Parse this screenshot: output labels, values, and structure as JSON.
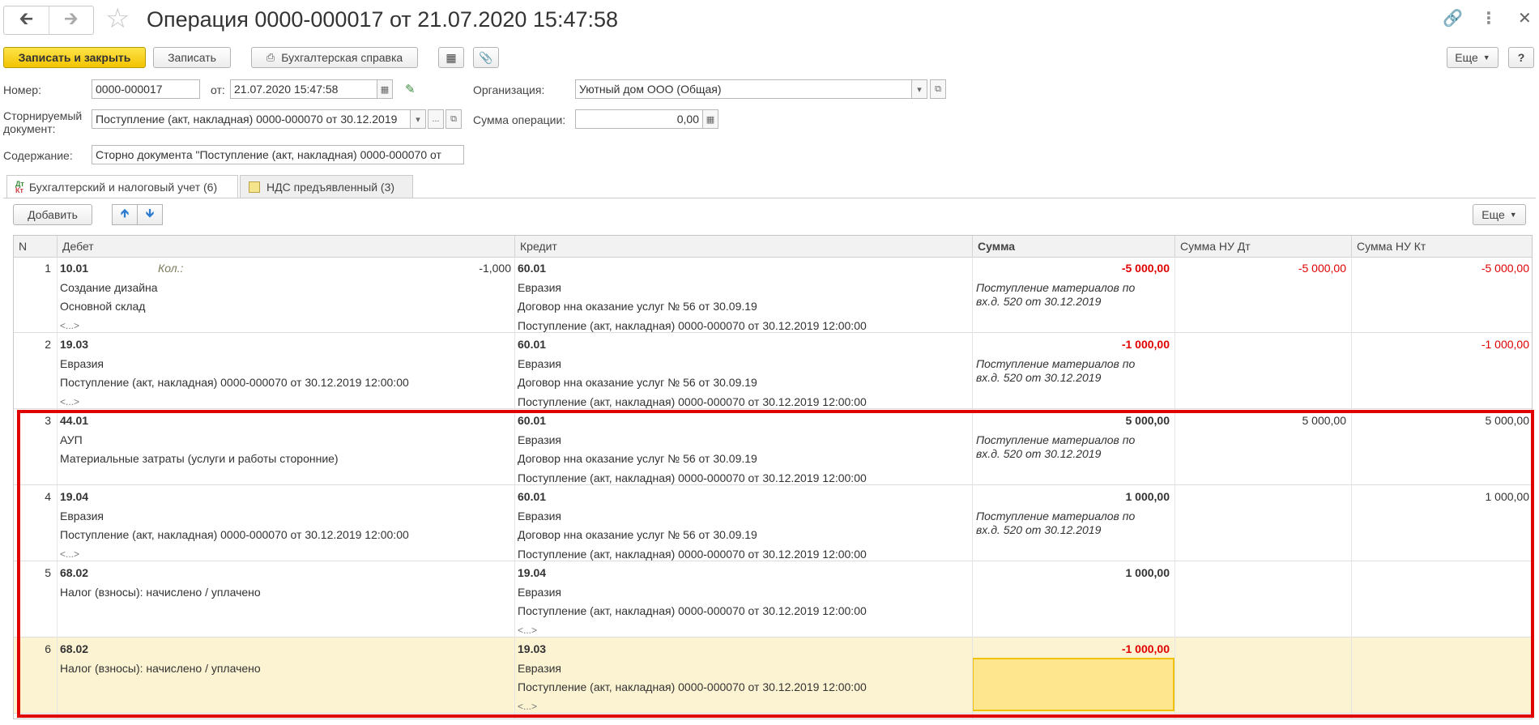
{
  "window": {
    "title": "Операция 0000-000017 от 21.07.2020 15:47:58"
  },
  "toolbar": {
    "save_close": "Записать и закрыть",
    "save": "Записать",
    "report": "Бухгалтерская справка",
    "more": "Еще",
    "help": "?"
  },
  "form": {
    "number_label": "Номер:",
    "number_value": "0000-000017",
    "date_label": "от:",
    "date_value": "21.07.2020 15:47:58",
    "org_label": "Организация:",
    "org_value": "Уютный дом ООО (Общая)",
    "storno_label_1": "Сторнируемый",
    "storno_label_2": "документ:",
    "storno_value": "Поступление (акт, накладная) 0000-000070 от 30.12.2019",
    "storno_more": "...",
    "sum_label": "Сумма операции:",
    "sum_value": "0,00",
    "content_label": "Содержание:",
    "content_value": "Сторно документа \"Поступление (акт, накладная) 0000-000070 от"
  },
  "tabs": [
    {
      "label": "Бухгалтерский и налоговый учет (6)",
      "icon_top": "Дт",
      "icon_bottom": "Кт"
    },
    {
      "label": "НДС предъявленный (3)"
    }
  ],
  "grid_toolbar": {
    "add": "Добавить",
    "more": "Еще"
  },
  "columns": [
    "N",
    "Дебет",
    "Кредит",
    "Сумма",
    "Сумма НУ Дт",
    "Сумма НУ Кт"
  ],
  "rows": [
    {
      "n": "1",
      "debit": [
        "10.01",
        "Создание дизайна",
        "Основной склад",
        "<...>"
      ],
      "qty_label": "Кол.:",
      "qty_value": "-1,000",
      "credit": [
        "60.01",
        "Евразия",
        "Договор нна оказание услуг № 56 от 30.09.19",
        "Поступление (акт, накладная) 0000-000070 от 30.12.2019 12:00:00"
      ],
      "sum": "-5 000,00",
      "sum_red": true,
      "note": [
        "Поступление материалов по",
        "вх.д. 520 от 30.12.2019"
      ],
      "nu_dt": "-5 000,00",
      "nu_kt": "-5 000,00"
    },
    {
      "n": "2",
      "debit": [
        "19.03",
        "Евразия",
        "Поступление (акт, накладная) 0000-000070 от 30.12.2019 12:00:00",
        "<...>"
      ],
      "credit": [
        "60.01",
        "Евразия",
        "Договор нна оказание услуг № 56 от 30.09.19",
        "Поступление (акт, накладная) 0000-000070 от 30.12.2019 12:00:00"
      ],
      "sum": "-1 000,00",
      "sum_red": true,
      "note": [
        "Поступление материалов по",
        "вх.д. 520 от 30.12.2019"
      ],
      "nu_dt": "",
      "nu_kt": "-1 000,00"
    },
    {
      "n": "3",
      "debit": [
        "44.01",
        "АУП",
        "Материальные затраты (услуги и работы сторонние)",
        ""
      ],
      "credit": [
        "60.01",
        "Евразия",
        "Договор нна оказание услуг № 56 от 30.09.19",
        "Поступление (акт, накладная) 0000-000070 от 30.12.2019 12:00:00"
      ],
      "sum": "5 000,00",
      "sum_red": false,
      "note": [
        "Поступление материалов по",
        "вх.д. 520 от 30.12.2019"
      ],
      "nu_dt": "5 000,00",
      "nu_kt": "5 000,00"
    },
    {
      "n": "4",
      "debit": [
        "19.04",
        "Евразия",
        "Поступление (акт, накладная) 0000-000070 от 30.12.2019 12:00:00",
        "<...>"
      ],
      "credit": [
        "60.01",
        "Евразия",
        "Договор нна оказание услуг № 56 от 30.09.19",
        "Поступление (акт, накладная) 0000-000070 от 30.12.2019 12:00:00"
      ],
      "sum": "1 000,00",
      "sum_red": false,
      "note": [
        "Поступление материалов по",
        "вх.д. 520 от 30.12.2019"
      ],
      "nu_dt": "",
      "nu_kt": "1 000,00"
    },
    {
      "n": "5",
      "debit": [
        "68.02",
        "Налог (взносы): начислено / уплачено",
        "",
        ""
      ],
      "credit": [
        "19.04",
        "Евразия",
        "Поступление (акт, накладная) 0000-000070 от 30.12.2019 12:00:00",
        "<...>"
      ],
      "sum": "1 000,00",
      "sum_red": false,
      "note": [
        "",
        ""
      ],
      "nu_dt": "",
      "nu_kt": ""
    },
    {
      "n": "6",
      "debit": [
        "68.02",
        "Налог (взносы): начислено / уплачено",
        "",
        ""
      ],
      "credit": [
        "19.03",
        "Евразия",
        "Поступление (акт, накладная) 0000-000070 от 30.12.2019 12:00:00",
        "<...>"
      ],
      "sum": "-1 000,00",
      "sum_red": true,
      "note": [
        "",
        ""
      ],
      "nu_dt": "",
      "nu_kt": "",
      "selected": true
    }
  ]
}
